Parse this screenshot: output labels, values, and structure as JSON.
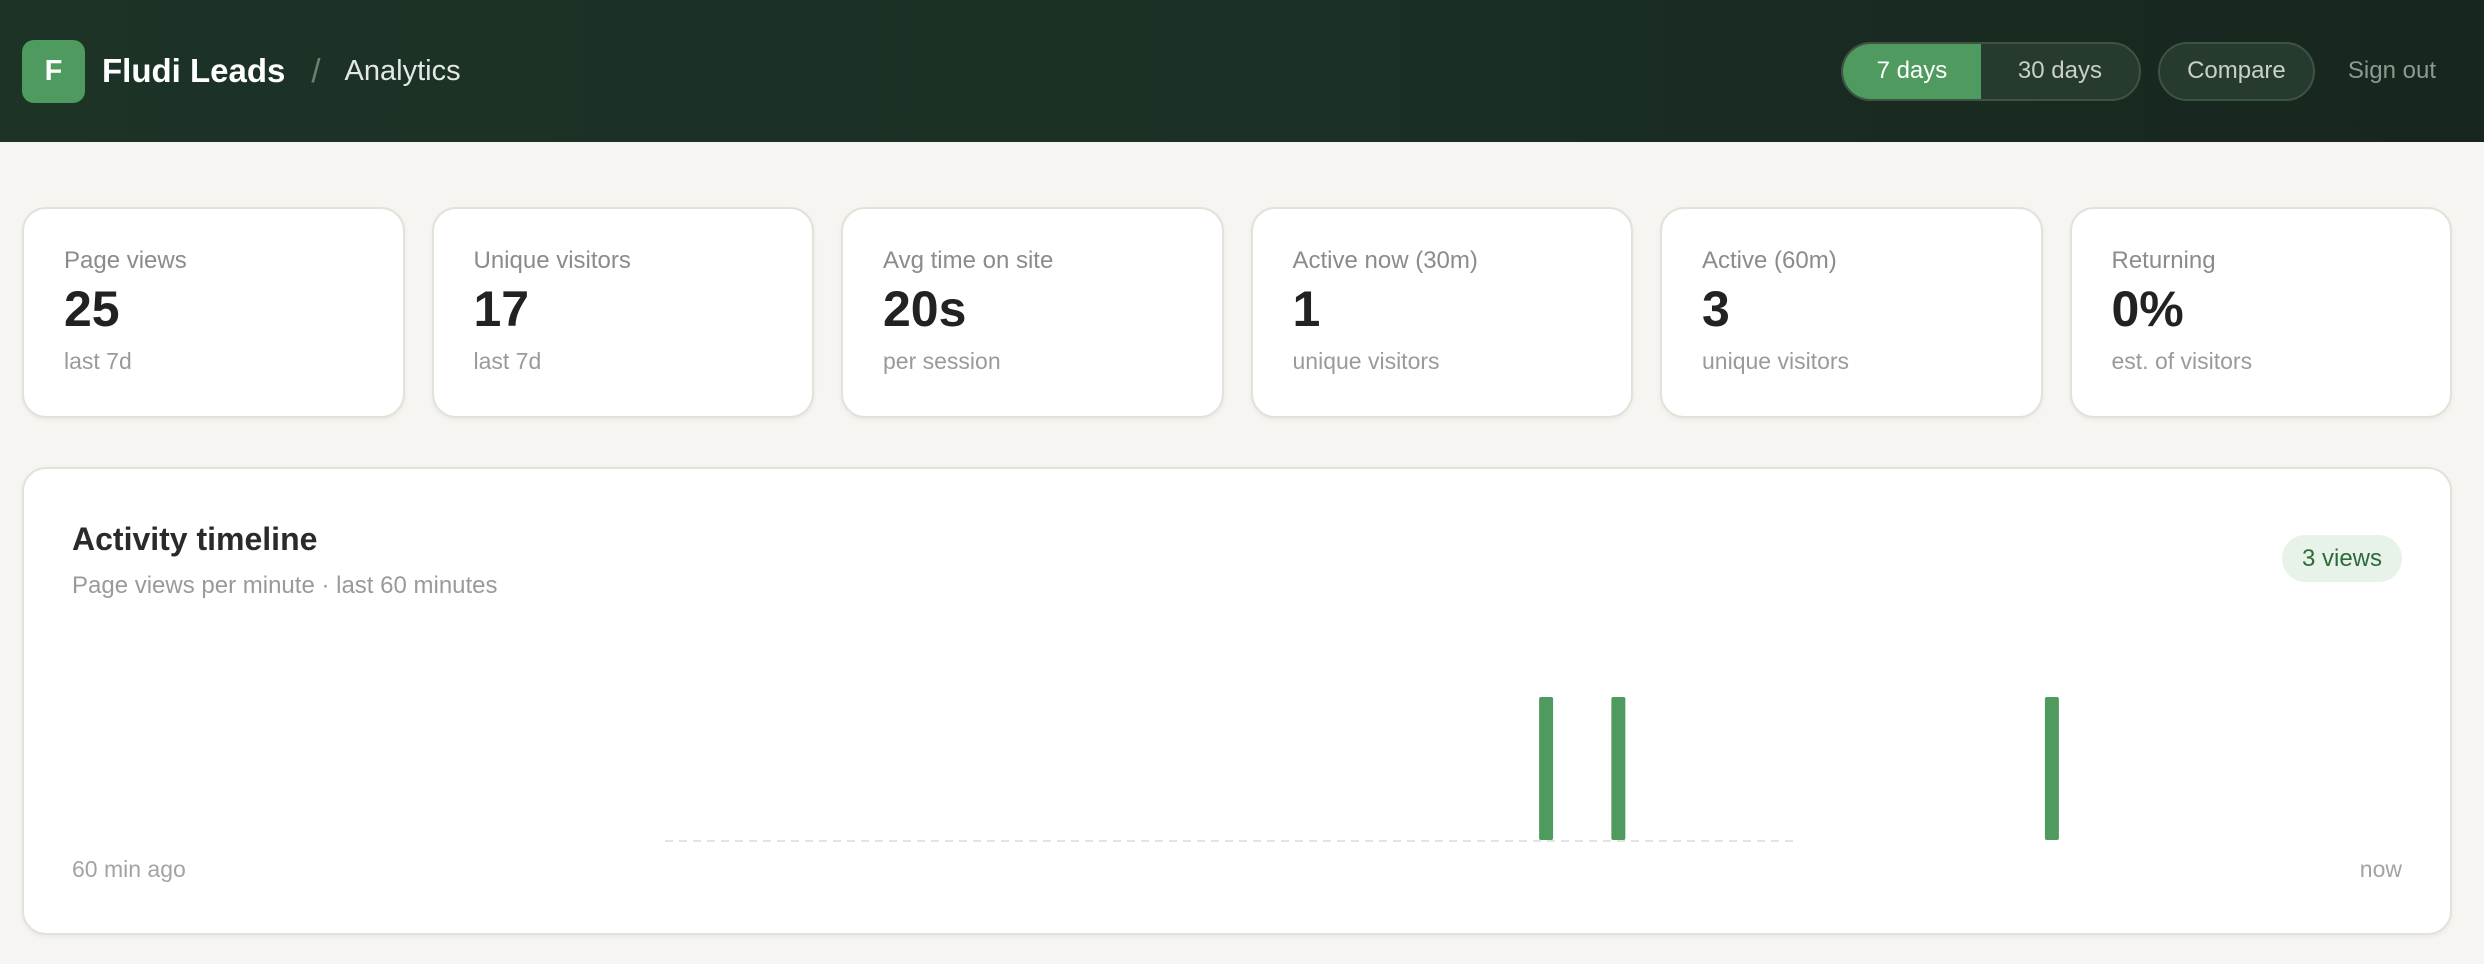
{
  "header": {
    "logo_letter": "F",
    "app_name": "Fludi Leads",
    "separator": "/",
    "section": "Analytics",
    "range_options": [
      {
        "label": "7 days",
        "active": true
      },
      {
        "label": "30 days",
        "active": false
      }
    ],
    "compare_label": "Compare",
    "signout_label": "Sign out"
  },
  "stats": [
    {
      "label": "Page views",
      "value": "25",
      "sub": "last 7d"
    },
    {
      "label": "Unique visitors",
      "value": "17",
      "sub": "last 7d"
    },
    {
      "label": "Avg time on site",
      "value": "20s",
      "sub": "per session"
    },
    {
      "label": "Active now (30m)",
      "value": "1",
      "sub": "unique visitors"
    },
    {
      "label": "Active (60m)",
      "value": "3",
      "sub": "unique visitors"
    },
    {
      "label": "Returning",
      "value": "0%",
      "sub": "est. of visitors"
    }
  ],
  "timeline": {
    "title": "Activity timeline",
    "subtitle": "Page views per minute · last 60 minutes",
    "badge": "3 views",
    "axis_start": "60 min ago",
    "axis_end": "now"
  },
  "colors": {
    "accent": "#4f9a5e",
    "header_bg": "#1b2f24",
    "badge_bg": "#e7f2e8",
    "badge_text": "#2e6b3b"
  },
  "chart_data": {
    "type": "bar",
    "title": "Activity timeline",
    "x": [
      24,
      26,
      38
    ],
    "values": [
      1,
      1,
      1
    ],
    "xlim": [
      0,
      31
    ],
    "ylim": [
      0,
      1
    ],
    "note_x_units": "minute index within the plotted window",
    "grid": false
  }
}
